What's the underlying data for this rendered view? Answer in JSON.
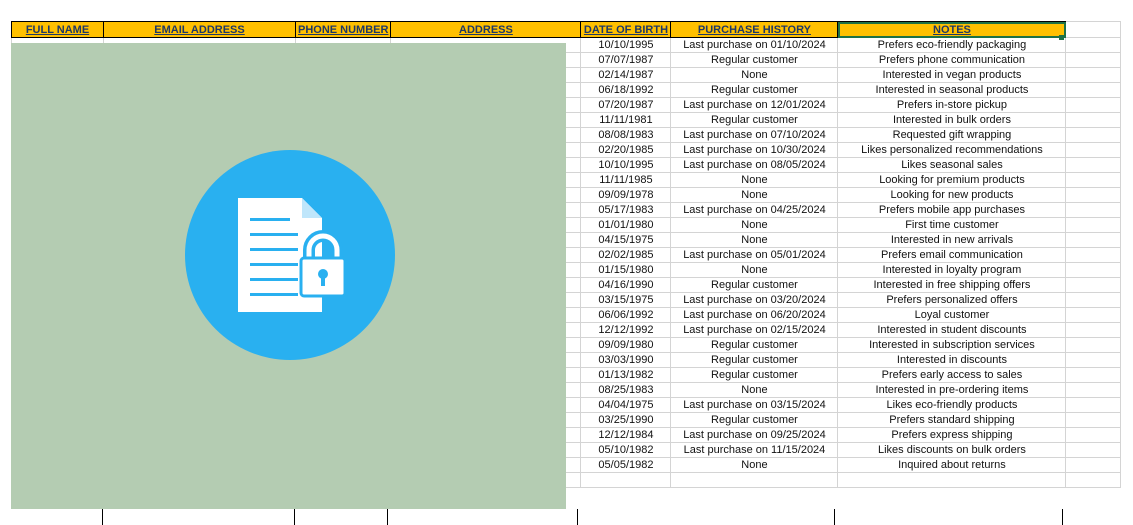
{
  "sheet": {
    "headers": [
      "FULL NAME",
      "EMAIL ADDRESS",
      "PHONE NUMBER",
      "ADDRESS",
      "DATE OF BIRTH",
      "PURCHASE HISTORY",
      "NOTES"
    ],
    "rows": [
      {
        "dob": "10/10/1995",
        "purchase": "Last purchase on 01/10/2024",
        "notes": "Prefers eco-friendly packaging"
      },
      {
        "dob": "07/07/1987",
        "purchase": "Regular customer",
        "notes": "Prefers phone communication"
      },
      {
        "dob": "02/14/1987",
        "purchase": "None",
        "notes": "Interested in vegan products"
      },
      {
        "dob": "06/18/1992",
        "purchase": "Regular customer",
        "notes": "Interested in seasonal products"
      },
      {
        "dob": "07/20/1987",
        "purchase": "Last purchase on 12/01/2024",
        "notes": "Prefers in-store pickup"
      },
      {
        "dob": "11/11/1981",
        "purchase": "Regular customer",
        "notes": "Interested in bulk orders"
      },
      {
        "dob": "08/08/1983",
        "purchase": "Last purchase on 07/10/2024",
        "notes": "Requested gift wrapping"
      },
      {
        "dob": "02/20/1985",
        "purchase": "Last purchase on 10/30/2024",
        "notes": "Likes personalized recommendations"
      },
      {
        "dob": "10/10/1995",
        "purchase": "Last purchase on 08/05/2024",
        "notes": "Likes seasonal sales"
      },
      {
        "dob": "11/11/1985",
        "purchase": "None",
        "notes": "Looking for premium products"
      },
      {
        "dob": "09/09/1978",
        "purchase": "None",
        "notes": "Looking for new products"
      },
      {
        "dob": "05/17/1983",
        "purchase": "Last purchase on 04/25/2024",
        "notes": "Prefers mobile app purchases"
      },
      {
        "dob": "01/01/1980",
        "purchase": "None",
        "notes": "First time customer"
      },
      {
        "dob": "04/15/1975",
        "purchase": "None",
        "notes": "Interested in new arrivals"
      },
      {
        "dob": "02/02/1985",
        "purchase": "Last purchase on 05/01/2024",
        "notes": "Prefers email communication"
      },
      {
        "dob": "01/15/1980",
        "purchase": "None",
        "notes": "Interested in loyalty program"
      },
      {
        "dob": "04/16/1990",
        "purchase": "Regular customer",
        "notes": "Interested in free shipping offers"
      },
      {
        "dob": "03/15/1975",
        "purchase": "Last purchase on 03/20/2024",
        "notes": "Prefers personalized offers"
      },
      {
        "dob": "06/06/1992",
        "purchase": "Last purchase on 06/20/2024",
        "notes": "Loyal customer"
      },
      {
        "dob": "12/12/1992",
        "purchase": "Last purchase on 02/15/2024",
        "notes": "Interested in student discounts"
      },
      {
        "dob": "09/09/1980",
        "purchase": "Regular customer",
        "notes": "Interested in subscription services"
      },
      {
        "dob": "03/03/1990",
        "purchase": "Regular customer",
        "notes": "Interested in discounts"
      },
      {
        "dob": "01/13/1982",
        "purchase": "Regular customer",
        "notes": "Prefers early access to sales"
      },
      {
        "dob": "08/25/1983",
        "purchase": "None",
        "notes": "Interested in pre-ordering items"
      },
      {
        "dob": "04/04/1975",
        "purchase": "Last purchase on 03/15/2024",
        "notes": "Likes eco-friendly products"
      },
      {
        "dob": "03/25/1990",
        "purchase": "Regular customer",
        "notes": "Prefers standard shipping"
      },
      {
        "dob": "12/12/1984",
        "purchase": "Last purchase on 09/25/2024",
        "notes": "Prefers express shipping"
      },
      {
        "dob": "05/10/1982",
        "purchase": "Last purchase on 11/15/2024",
        "notes": "Likes discounts on bulk orders"
      },
      {
        "dob": "05/05/1982",
        "purchase": "None",
        "notes": "Inquired about returns"
      }
    ]
  },
  "overlay": {
    "color": "#b4ccb2",
    "circle_color": "#29b0f0",
    "icon": "locked-document-icon"
  },
  "colors": {
    "header_fill": "#ffc000",
    "header_text": "#1f3864",
    "selection": "#1e7145"
  }
}
